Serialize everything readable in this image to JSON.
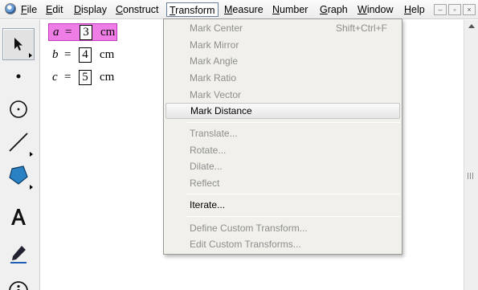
{
  "menubar": {
    "items": [
      "File",
      "Edit",
      "Display",
      "Construct",
      "Transform",
      "Measure",
      "Number",
      "Graph",
      "Window",
      "Help"
    ],
    "active": "Transform",
    "window_controls": [
      "–",
      "▫",
      "×"
    ]
  },
  "toolbox": {
    "tools": [
      "arrow-select-icon",
      "point-icon",
      "compass-icon",
      "straightedge-icon",
      "polygon-icon",
      "text-icon",
      "marker-icon",
      "information-icon"
    ]
  },
  "canvas": {
    "params": [
      {
        "name": "a",
        "eq": "=",
        "value": "3",
        "unit": "cm",
        "highlighted": true
      },
      {
        "name": "b",
        "eq": "=",
        "value": "4",
        "unit": "cm",
        "highlighted": false
      },
      {
        "name": "c",
        "eq": "=",
        "value": "5",
        "unit": "cm",
        "highlighted": false
      }
    ]
  },
  "dropdown": {
    "items": [
      {
        "label": "Mark Center",
        "shortcut": "Shift+Ctrl+F",
        "enabled": false
      },
      {
        "label": "Mark Mirror",
        "shortcut": "",
        "enabled": false
      },
      {
        "label": "Mark Angle",
        "shortcut": "",
        "enabled": false
      },
      {
        "label": "Mark Ratio",
        "shortcut": "",
        "enabled": false
      },
      {
        "label": "Mark Vector",
        "shortcut": "",
        "enabled": false
      },
      {
        "label": "Mark Distance",
        "shortcut": "",
        "enabled": true,
        "hover": true
      },
      {
        "label": "Translate...",
        "shortcut": "",
        "enabled": false
      },
      {
        "label": "Rotate...",
        "shortcut": "",
        "enabled": false
      },
      {
        "label": "Dilate...",
        "shortcut": "",
        "enabled": false
      },
      {
        "label": "Reflect",
        "shortcut": "",
        "enabled": false
      },
      {
        "label": "Iterate...",
        "shortcut": "",
        "enabled": true
      },
      {
        "label": "Define Custom Transform...",
        "shortcut": "",
        "enabled": false
      },
      {
        "label": "Edit Custom Transforms...",
        "shortcut": "",
        "enabled": false
      }
    ]
  },
  "colors": {
    "highlight": "#ee7ee6",
    "disabled_text": "#8d8d8d",
    "menu_bg": "#f1f0eb"
  }
}
